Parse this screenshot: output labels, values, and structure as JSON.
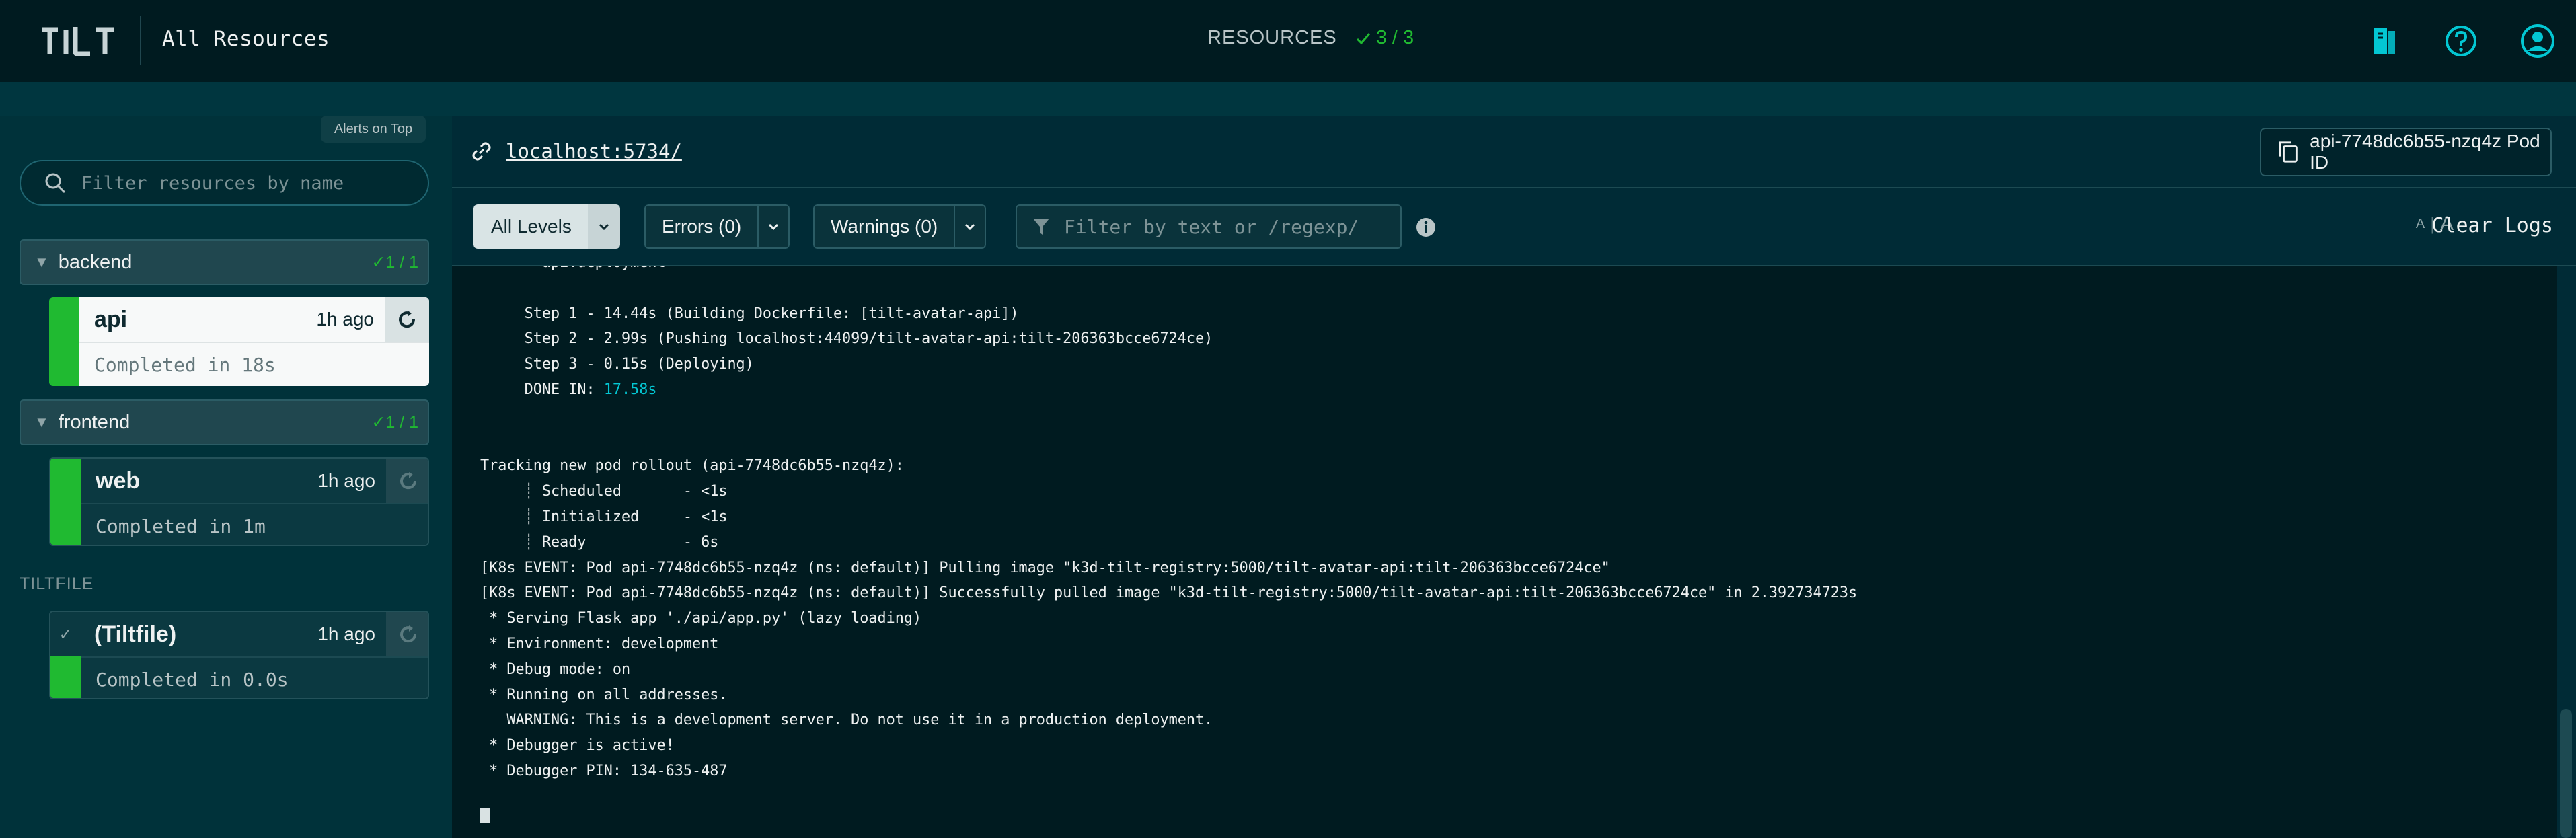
{
  "header": {
    "logo_text": "TILT",
    "title": "All Resources",
    "resources_label": "RESOURCES",
    "resources_count": "3 / 3",
    "icons": [
      "book-icon",
      "help-icon",
      "account-icon"
    ]
  },
  "sidebar": {
    "alerts_toggle": "Alerts on Top",
    "filter_placeholder": "Filter resources by name",
    "groups": [
      {
        "name": "backend",
        "count": "1 / 1",
        "resources": [
          {
            "name": "api",
            "time": "1h ago",
            "status": "Completed in 18s",
            "selected": true
          }
        ]
      },
      {
        "name": "frontend",
        "count": "1 / 1",
        "resources": [
          {
            "name": "web",
            "time": "1h ago",
            "status": "Completed in 1m",
            "selected": false
          }
        ]
      }
    ],
    "tiltfile_heading": "TILTFILE",
    "tiltfile": {
      "name": "(Tiltfile)",
      "time": "1h ago",
      "status": "Completed in 0.0s"
    }
  },
  "main": {
    "endpoint": "localhost:5734/",
    "pod_id": "api-7748dc6b55-nzq4z Pod ID",
    "levels": {
      "all": "All Levels",
      "errors": "Errors (0)",
      "warnings": "Warnings (0)"
    },
    "log_filter_placeholder": "Filter by text or /regexp/",
    "font_small": "A",
    "font_large": "A",
    "clear_logs": "Clear Logs",
    "log_lines": [
      "     → api:deployment",
      "",
      "     Step 1 - 14.44s (Building Dockerfile: [tilt-avatar-api])",
      "     Step 2 - 2.99s (Pushing localhost:44099/tilt-avatar-api:tilt-206363bcce6724ce)",
      "     Step 3 - 0.15s (Deploying)",
      "     DONE IN: ",
      "",
      "",
      "Tracking new pod rollout (api-7748dc6b55-nzq4z):",
      "     ┊ Scheduled       - <1s",
      "     ┊ Initialized     - <1s",
      "     ┊ Ready           - 6s",
      "[K8s EVENT: Pod api-7748dc6b55-nzq4z (ns: default)] Pulling image \"k3d-tilt-registry:5000/tilt-avatar-api:tilt-206363bcce6724ce\"",
      "[K8s EVENT: Pod api-7748dc6b55-nzq4z (ns: default)] Successfully pulled image \"k3d-tilt-registry:5000/tilt-avatar-api:tilt-206363bcce6724ce\" in 2.392734723s",
      " * Serving Flask app './api/app.py' (lazy loading)",
      " * Environment: development",
      " * Debug mode: on",
      " * Running on all addresses.",
      "   WARNING: This is a development server. Do not use it in a production deployment.",
      " * Debugger is active!",
      " * Debugger PIN: 134-635-487"
    ],
    "done_in_value": "17.58s"
  },
  "colors": {
    "topbar": "#001b20",
    "background": "#002b36",
    "success": "#20ba31",
    "accent": "#03c7d3"
  }
}
